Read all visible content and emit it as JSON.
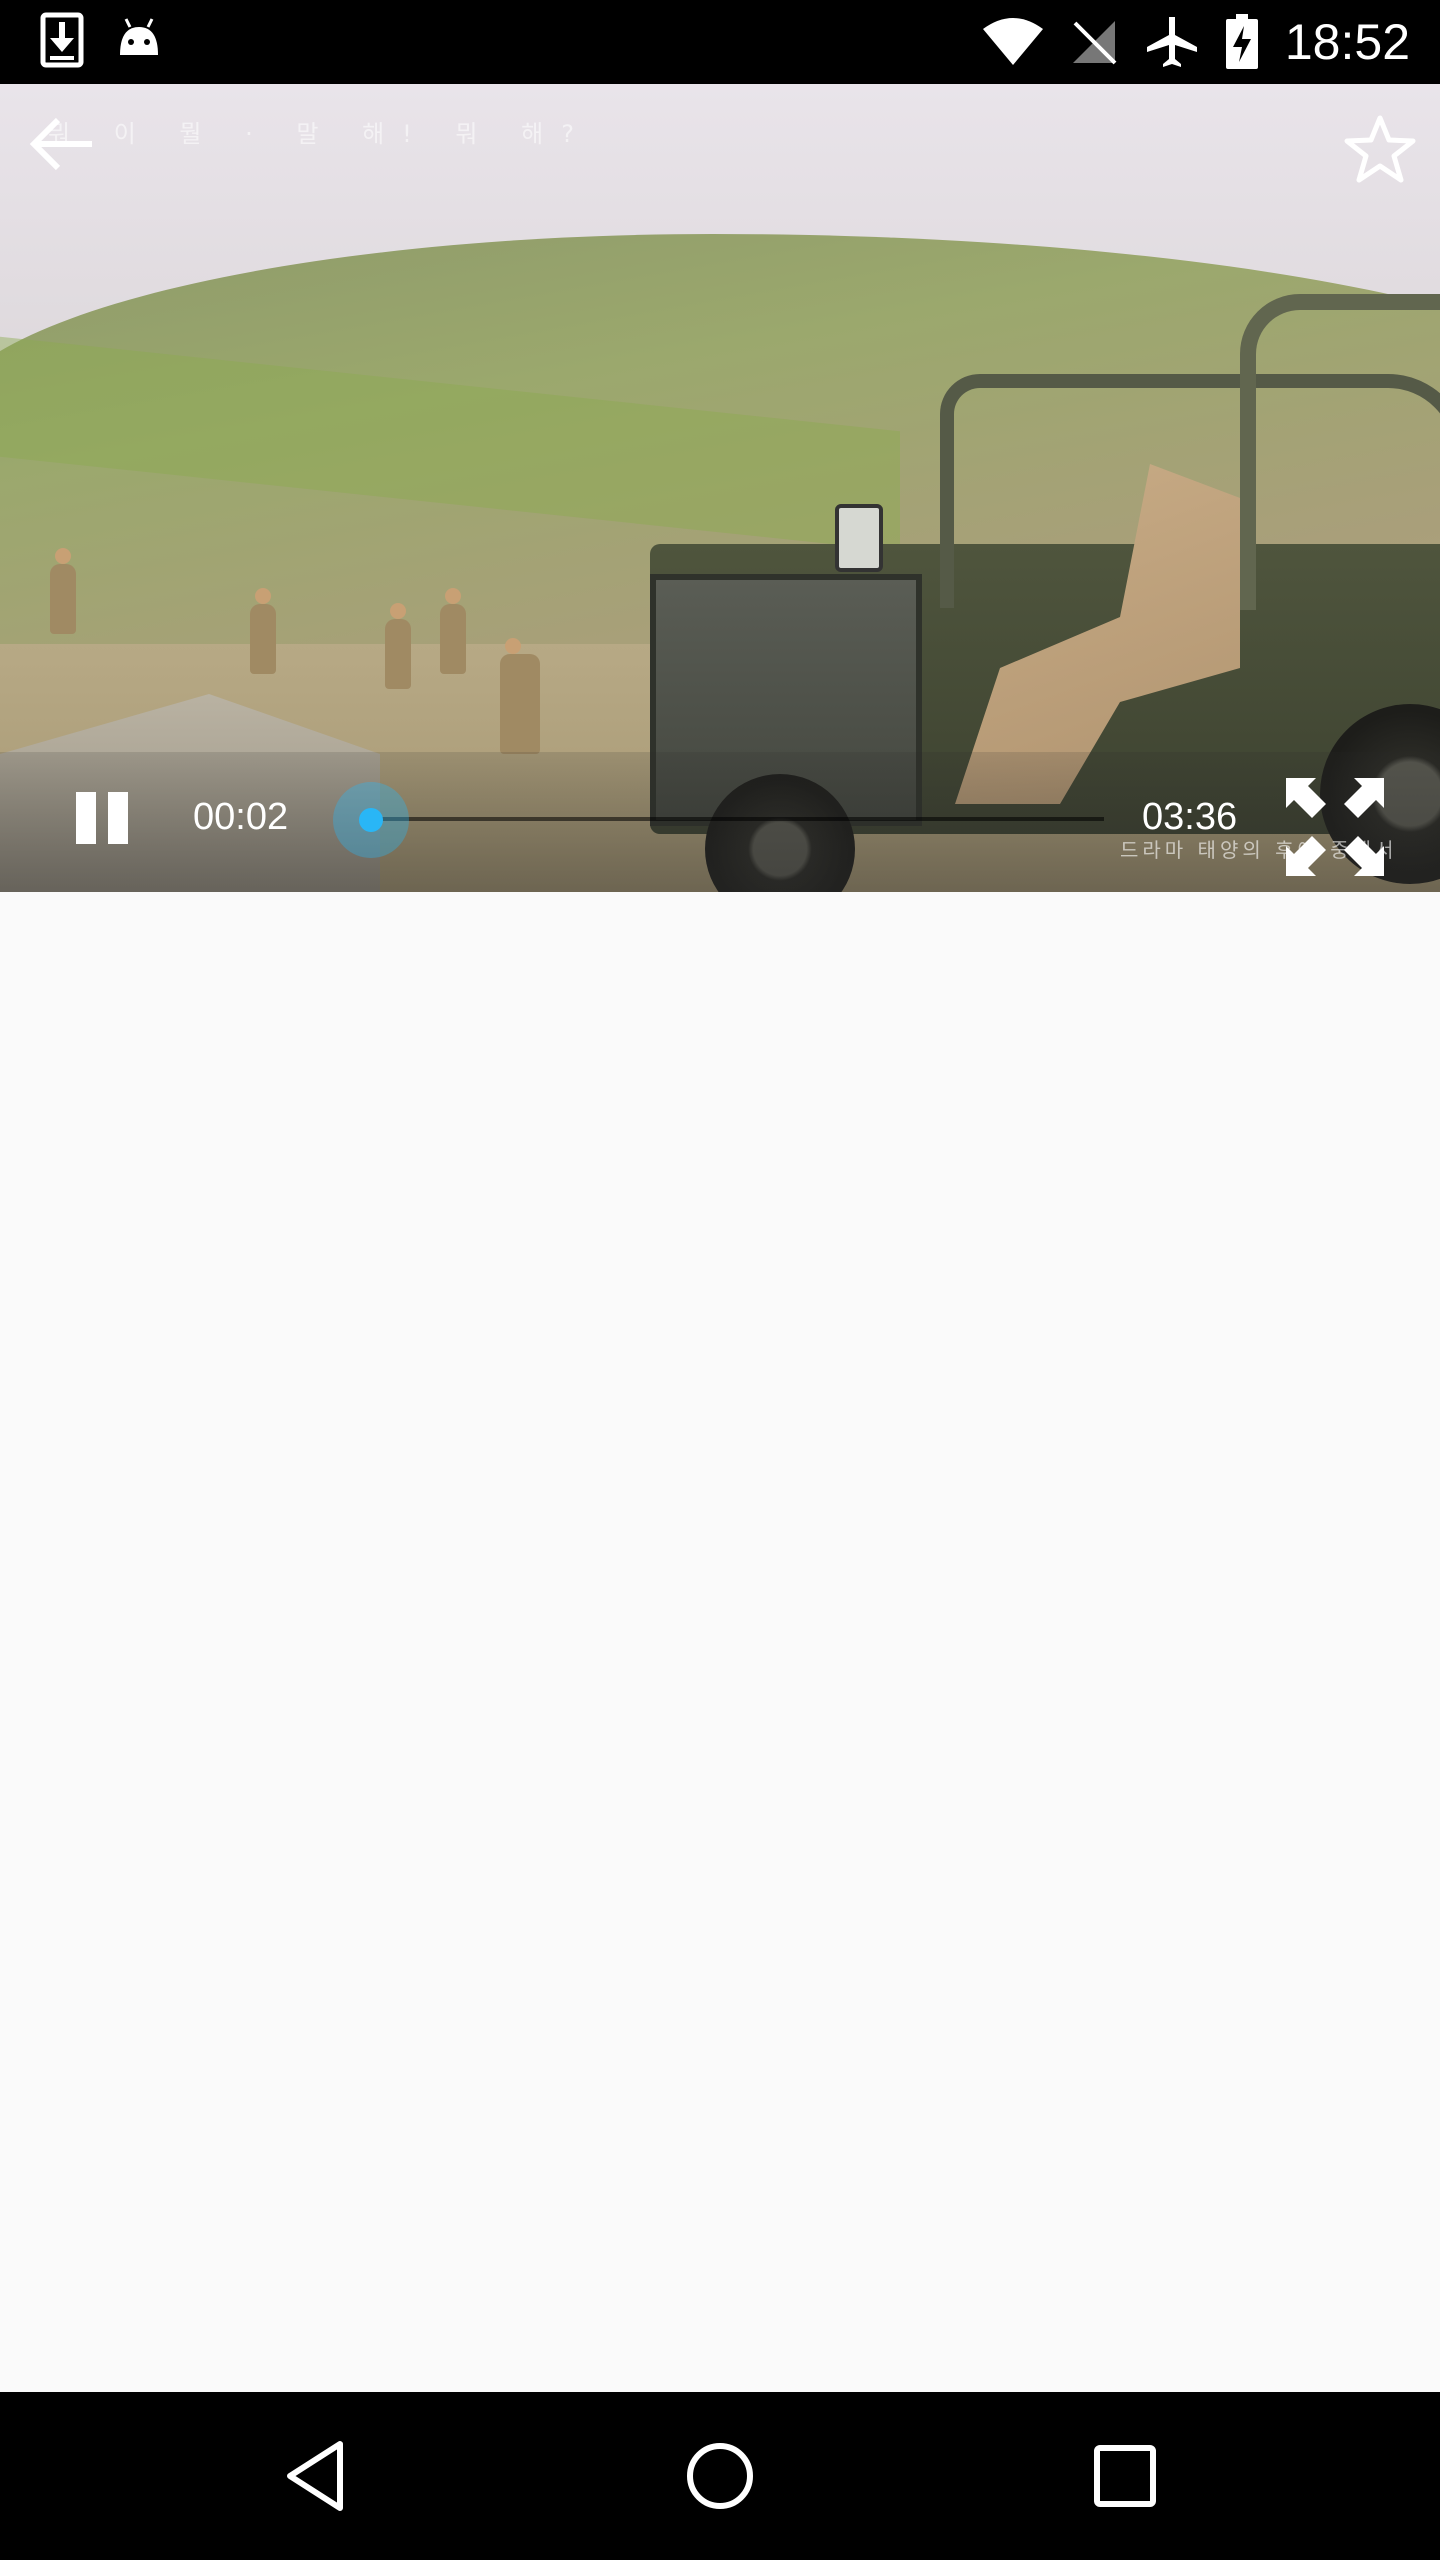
{
  "status_bar": {
    "time": "18:52",
    "left_icons": [
      "download-icon",
      "android-icon"
    ],
    "right_icons": [
      "wifi-icon",
      "no-sim-icon",
      "airplane-mode-icon",
      "battery-charging-icon"
    ]
  },
  "player": {
    "subtitle_top": "뭐 이 뭘 · 말 해! 뭐 해?",
    "current_time": "00:02",
    "total_time": "03:36",
    "progress": 0.01,
    "subtitle_bottom": "드라마 태양의 후예 중에서",
    "accent_color": "#29b6f6"
  },
  "navigation": {
    "buttons": [
      "back-nav-icon",
      "home-nav-icon",
      "recents-nav-icon"
    ]
  }
}
